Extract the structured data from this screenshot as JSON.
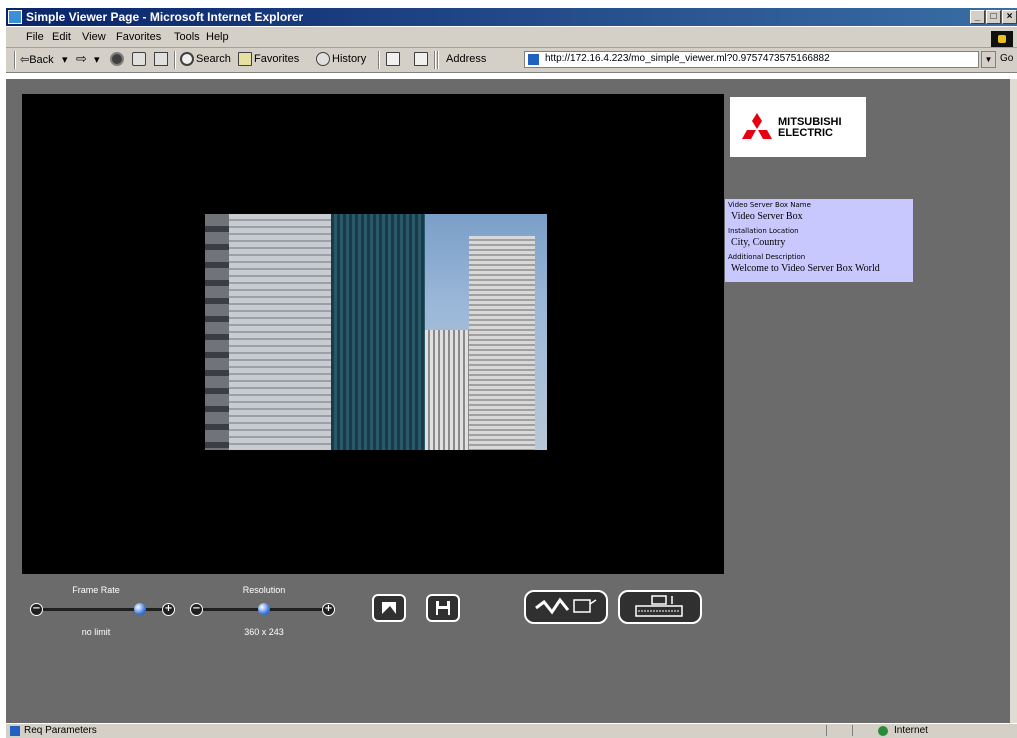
{
  "window": {
    "title": "Simple Viewer Page - Microsoft Internet Explorer",
    "minimize": "_",
    "maximize": "□",
    "close": "×"
  },
  "menu": [
    "File",
    "Edit",
    "View",
    "Favorites",
    "Tools",
    "Help"
  ],
  "toolbar": {
    "back": "⇦Back",
    "back_arrow": "▾",
    "forward": "⇨",
    "forward_arrow": "▾",
    "search": "Search",
    "favorites": "Favorites",
    "history": "History",
    "address_label": "Address",
    "address_url": "http://172.16.4.223/mo_simple_viewer.ml?0.9757473575166882",
    "go": "Go"
  },
  "brand": {
    "logo_line1": "MITSUBISHI",
    "logo_line2": "ELECTRIC",
    "logo_color": "#e60012"
  },
  "info": {
    "name_label": "Video Server Box Name",
    "name_value": "Video Server Box",
    "location_label": "Installation Location",
    "location_value": "City, Country",
    "description_label": "Additional Description",
    "description_value": "Welcome to Video Server Box World"
  },
  "controls": {
    "frame_rate_label": "Frame Rate",
    "frame_rate_value": "no limit",
    "frame_rate_level": 0.78,
    "resolution_label": "Resolution",
    "resolution_value": "360 x 243",
    "resolution_level": 0.5,
    "minus": "−",
    "plus": "+"
  },
  "status": {
    "text": "Req Parameters",
    "zone": "Internet"
  },
  "colors": {
    "page_bg": "#6b6b6b",
    "info_bg": "#c8c8ff",
    "slider_thumb": "#3a7ae0"
  }
}
